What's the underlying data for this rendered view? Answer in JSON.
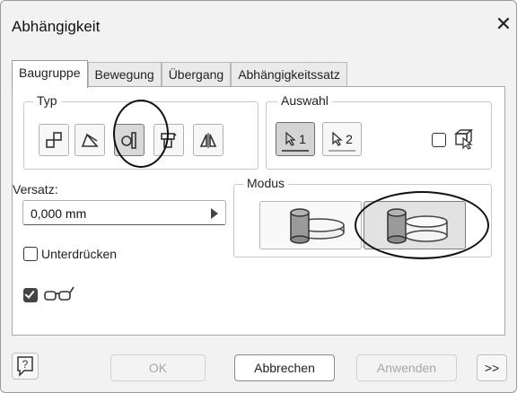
{
  "window": {
    "title": "Abhängigkeit",
    "close_symbol": "✕"
  },
  "tabs": [
    {
      "label": "Baugruppe",
      "active": true
    },
    {
      "label": "Bewegung",
      "active": false
    },
    {
      "label": "Übergang",
      "active": false
    },
    {
      "label": "Abhängigkeitssatz",
      "active": false
    }
  ],
  "type_group": {
    "label": "Typ",
    "buttons": [
      {
        "icon": "mate-icon",
        "selected": false
      },
      {
        "icon": "angle-icon",
        "selected": false
      },
      {
        "icon": "tangent-icon",
        "selected": true
      },
      {
        "icon": "insert-icon",
        "selected": false
      },
      {
        "icon": "symmetry-icon",
        "selected": false
      }
    ]
  },
  "selection_group": {
    "label": "Auswahl",
    "select1_label": "1",
    "select2_label": "2"
  },
  "offset": {
    "label": "Versatz:",
    "value": "0,000 mm"
  },
  "mode_group": {
    "label": "Modus",
    "options": [
      {
        "icon": "tangent-inside-icon",
        "active": false
      },
      {
        "icon": "tangent-outside-icon",
        "active": true
      }
    ]
  },
  "suppress": {
    "label": "Unterdrücken",
    "checked": false
  },
  "preview": {
    "checked": true,
    "icon": "glasses-icon"
  },
  "footer": {
    "ok_label": "OK",
    "cancel_label": "Abbrechen",
    "apply_label": "Anwenden",
    "more_label": ">>"
  },
  "colors": {
    "annotation": "#111111",
    "panel": "#ffffff",
    "chrome": "#f2f2f2"
  }
}
